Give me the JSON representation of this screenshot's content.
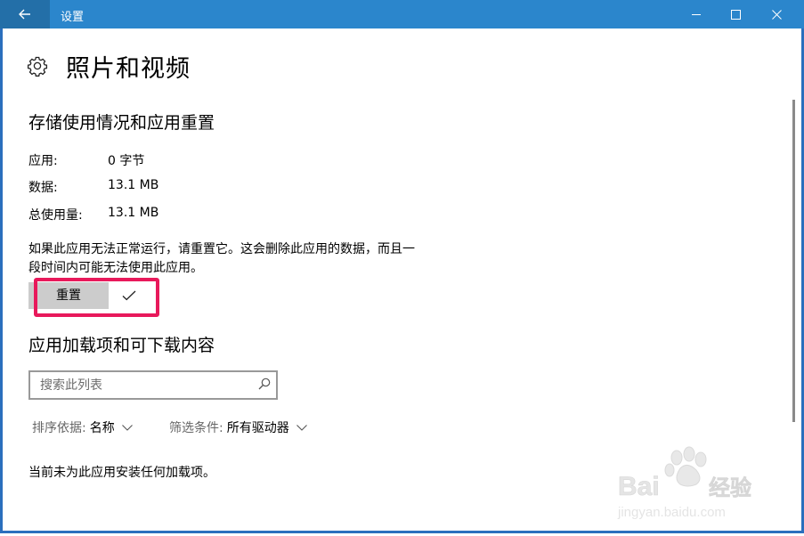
{
  "window": {
    "title": "设置",
    "accent": "#2b86cc",
    "controls": [
      "minimize-icon",
      "maximize-icon",
      "close-icon"
    ]
  },
  "page": {
    "title": "照片和视频",
    "icon": "gear-icon"
  },
  "storage": {
    "heading": "存储使用情况和应用重置",
    "rows": [
      {
        "label": "应用:",
        "value": "0 字节"
      },
      {
        "label": "数据:",
        "value": "13.1 MB"
      },
      {
        "label": "总使用量:",
        "value": "13.1 MB"
      }
    ],
    "description": "如果此应用无法正常运行，请重置它。这会删除此应用的数据，而且一段时间内可能无法使用此应用。",
    "reset_label": "重置",
    "highlight_color": "#e8195b"
  },
  "addons": {
    "heading": "应用加载项和可下载内容",
    "search_placeholder": "搜索此列表",
    "sort_label": "排序依据:",
    "sort_value": "名称",
    "filter_label": "筛选条件:",
    "filter_value": "所有驱动器",
    "empty_message": "当前未为此应用安装任何加载项。"
  },
  "watermark": {
    "brand": "Bai du 经验",
    "url": "jingyan.baidu.com"
  }
}
